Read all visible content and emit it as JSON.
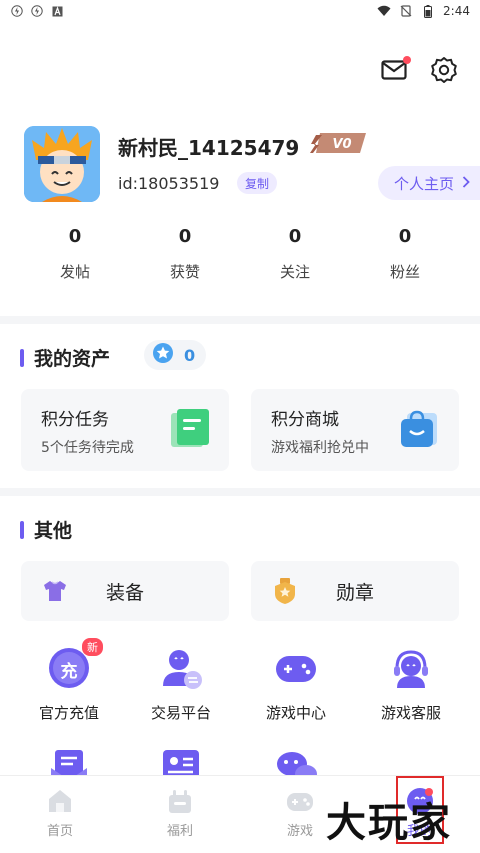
{
  "status_bar": {
    "time": "2:44",
    "left_icons": [
      "flash-icon",
      "flash-icon",
      "a-icon"
    ],
    "right_icons": [
      "wifi-icon",
      "no-sim-icon",
      "battery-icon"
    ]
  },
  "header": {
    "icons": [
      "mail-icon",
      "settings-icon"
    ],
    "mail_has_dot": true
  },
  "profile": {
    "username": "新村民_14125479",
    "vip_label": "V0",
    "uid": "id:18053519",
    "copy_label": "复制",
    "home_label": "个人主页"
  },
  "stats": [
    {
      "value": "0",
      "label": "发帖"
    },
    {
      "value": "0",
      "label": "获赞"
    },
    {
      "value": "0",
      "label": "关注"
    },
    {
      "value": "0",
      "label": "粉丝"
    }
  ],
  "assets": {
    "title": "我的资产",
    "coin_value": "0",
    "cards": [
      {
        "title": "积分任务",
        "subtitle": "5个任务待完成",
        "icon": "task-icon"
      },
      {
        "title": "积分商城",
        "subtitle": "游戏福利抢兑中",
        "icon": "shop-bag-icon"
      }
    ]
  },
  "other": {
    "title": "其他",
    "big_buttons": [
      {
        "label": "装备",
        "icon": "tshirt-icon"
      },
      {
        "label": "勋章",
        "icon": "medal-icon"
      }
    ],
    "grid": [
      {
        "label": "官方充值",
        "icon": "recharge-icon",
        "glyph": "充",
        "badge": "新"
      },
      {
        "label": "交易平台",
        "icon": "trade-icon"
      },
      {
        "label": "游戏中心",
        "icon": "gamepad-icon"
      },
      {
        "label": "游戏客服",
        "icon": "headset-icon"
      }
    ],
    "partial_row_icons": [
      "mail-list-icon",
      "id-card-icon",
      "chat-bubble-icon"
    ]
  },
  "tabs": [
    {
      "label": "首页",
      "icon": "home-icon",
      "active": false
    },
    {
      "label": "福利",
      "icon": "gift-icon",
      "active": false
    },
    {
      "label": "游戏",
      "icon": "game-icon",
      "active": false
    },
    {
      "label": "我的",
      "icon": "profile-icon",
      "active": true
    }
  ],
  "watermark": "大玩家",
  "colors": {
    "accent": "#6d5cf0",
    "red": "#ff4d5e",
    "blue": "#3a8fe0"
  }
}
